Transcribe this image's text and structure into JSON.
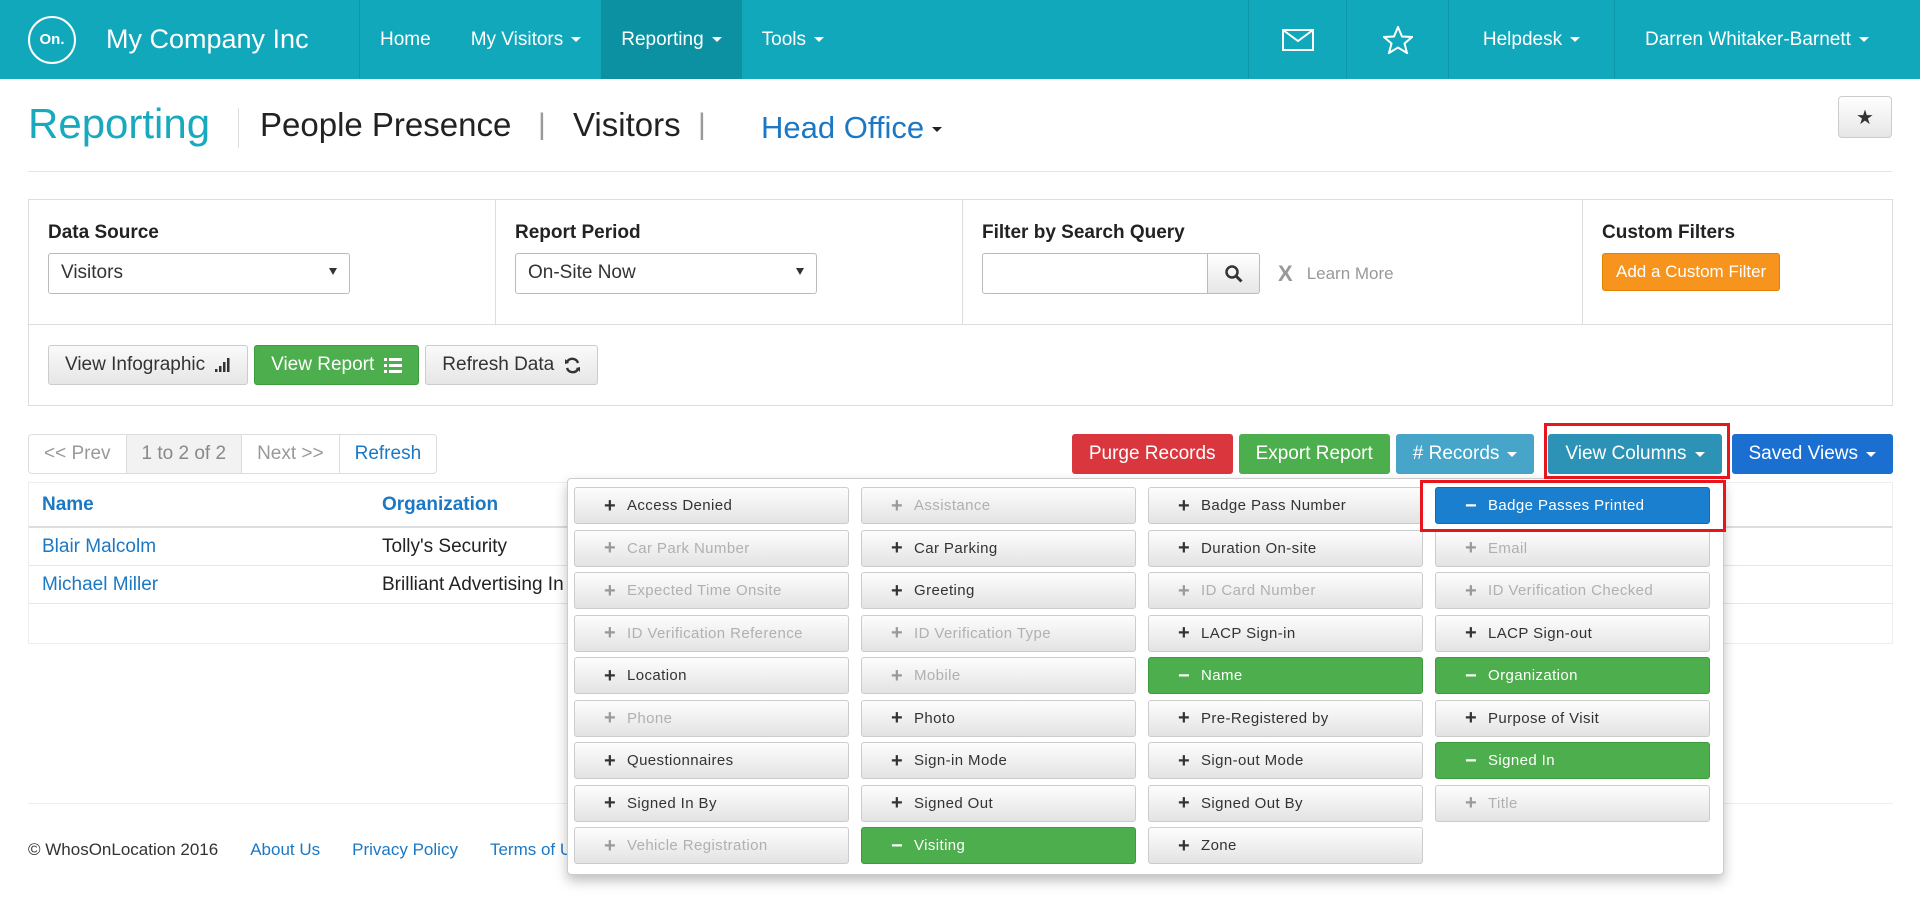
{
  "nav": {
    "logo": "On.",
    "brand": "My Company Inc",
    "items": [
      {
        "label": "Home",
        "dropdown": false
      },
      {
        "label": "My Visitors",
        "dropdown": true
      },
      {
        "label": "Reporting",
        "dropdown": true
      },
      {
        "label": "Tools",
        "dropdown": true
      }
    ],
    "helpdesk": "Helpdesk",
    "user": "Darren Whitaker-Barnett"
  },
  "header": {
    "title": "Reporting",
    "crumb1": "People Presence",
    "sep1": "|",
    "crumb2": "Visitors",
    "sep2": "|",
    "site": "Head Office",
    "star": "★"
  },
  "filters": {
    "data_source_label": "Data Source",
    "data_source_value": "Visitors",
    "report_period_label": "Report Period",
    "report_period_value": "On-Site Now",
    "search_label": "Filter by Search Query",
    "search_value": "",
    "learn_more_x": "X",
    "learn_more": "Learn More",
    "custom_label": "Custom Filters",
    "custom_button": "Add a Custom Filter"
  },
  "actions": {
    "infographic": "View Infographic",
    "view_report": "View Report",
    "refresh_data": "Refresh Data"
  },
  "pager": {
    "prev": "<< Prev",
    "range": "1 to 2 of 2",
    "next": "Next >>",
    "refresh": "Refresh"
  },
  "toolbar": {
    "purge": "Purge Records",
    "export": "Export Report",
    "records": "# Records",
    "view_columns": "View Columns",
    "saved_views": "Saved Views"
  },
  "table": {
    "headers": [
      "Name",
      "Organization"
    ],
    "rows": [
      [
        "Blair Malcolm",
        "Tolly's Security"
      ],
      [
        "Michael Miller",
        "Brilliant Advertising In"
      ]
    ]
  },
  "footer": {
    "copyright": "© WhosOnLocation 2016",
    "about": "About Us",
    "privacy": "Privacy Policy",
    "terms": "Terms of Us"
  },
  "columns_menu": [
    {
      "label": "Access Denied",
      "state": "add"
    },
    {
      "label": "Assistance",
      "state": "disabled"
    },
    {
      "label": "Badge Pass Number",
      "state": "add"
    },
    {
      "label": "Badge Passes Printed",
      "state": "primary"
    },
    {
      "label": "Car Park Number",
      "state": "disabled"
    },
    {
      "label": "Car Parking",
      "state": "add"
    },
    {
      "label": "Duration On-site",
      "state": "add"
    },
    {
      "label": "Email",
      "state": "disabled"
    },
    {
      "label": "Expected Time Onsite",
      "state": "disabled"
    },
    {
      "label": "Greeting",
      "state": "add"
    },
    {
      "label": "ID Card Number",
      "state": "disabled"
    },
    {
      "label": "ID Verification Checked",
      "state": "disabled"
    },
    {
      "label": "ID Verification Reference",
      "state": "disabled"
    },
    {
      "label": "ID Verification Type",
      "state": "disabled"
    },
    {
      "label": "LACP Sign-in",
      "state": "add"
    },
    {
      "label": "LACP Sign-out",
      "state": "add"
    },
    {
      "label": "Location",
      "state": "add"
    },
    {
      "label": "Mobile",
      "state": "disabled"
    },
    {
      "label": "Name",
      "state": "selected"
    },
    {
      "label": "Organization",
      "state": "selected"
    },
    {
      "label": "Phone",
      "state": "disabled"
    },
    {
      "label": "Photo",
      "state": "add"
    },
    {
      "label": "Pre-Registered by",
      "state": "add"
    },
    {
      "label": "Purpose of Visit",
      "state": "add"
    },
    {
      "label": "Questionnaires",
      "state": "add"
    },
    {
      "label": "Sign-in Mode",
      "state": "add"
    },
    {
      "label": "Sign-out Mode",
      "state": "add"
    },
    {
      "label": "Signed In",
      "state": "selected"
    },
    {
      "label": "Signed In By",
      "state": "add"
    },
    {
      "label": "Signed Out",
      "state": "add"
    },
    {
      "label": "Signed Out By",
      "state": "add"
    },
    {
      "label": "Title",
      "state": "disabled"
    },
    {
      "label": "Vehicle Registration",
      "state": "disabled"
    },
    {
      "label": "Visiting",
      "state": "selected"
    },
    {
      "label": "Zone",
      "state": "add"
    }
  ],
  "colors": {
    "nav_bg": "#11a8bb",
    "primary_link": "#1b78c4",
    "selected_green": "#4cae4c",
    "highlight_red": "#e8151d"
  }
}
